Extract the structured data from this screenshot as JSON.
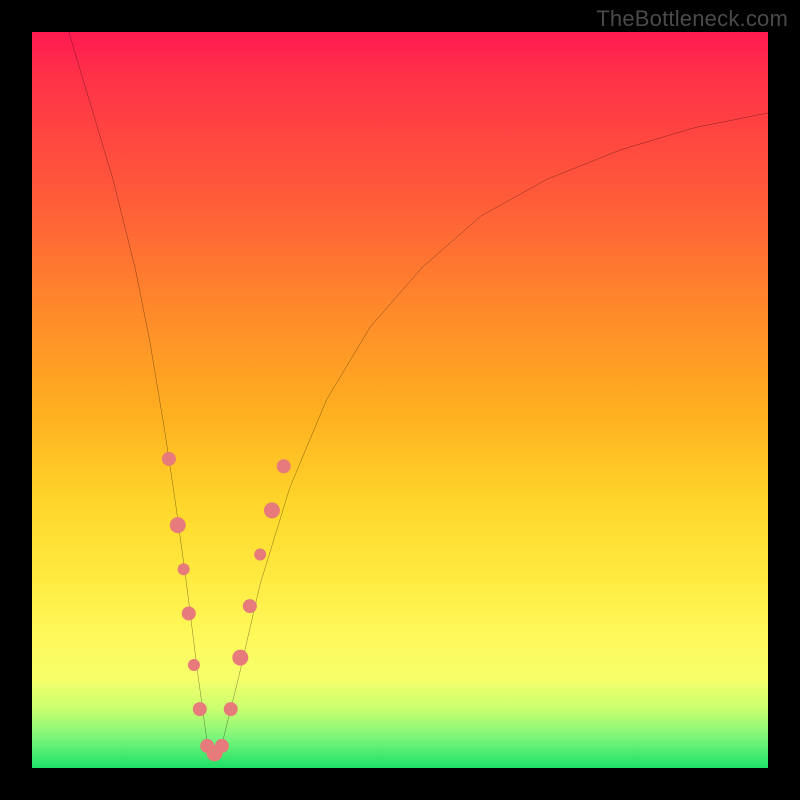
{
  "watermark": "TheBottleneck.com",
  "chart_data": {
    "type": "line",
    "title": "",
    "xlabel": "",
    "ylabel": "",
    "ylim": [
      0,
      100
    ],
    "xlim": [
      0,
      100
    ],
    "series": [
      {
        "name": "bottleneck-curve",
        "x": [
          5,
          8,
          11,
          14,
          16,
          18,
          19.5,
          21,
          22.5,
          24,
          25.5,
          28,
          31,
          35,
          40,
          46,
          53,
          61,
          70,
          80,
          90,
          100
        ],
        "values": [
          100,
          90,
          80,
          68,
          58,
          46,
          36,
          25,
          13,
          2,
          2,
          12,
          25,
          38,
          50,
          60,
          68,
          75,
          80,
          84,
          87,
          89
        ]
      }
    ],
    "markers": {
      "name": "highlight-beads",
      "color": "#e77a7a",
      "points": [
        {
          "x": 18.6,
          "y": 42,
          "r": 7
        },
        {
          "x": 19.8,
          "y": 33,
          "r": 8
        },
        {
          "x": 20.6,
          "y": 27,
          "r": 6
        },
        {
          "x": 21.3,
          "y": 21,
          "r": 7
        },
        {
          "x": 22.0,
          "y": 14,
          "r": 6
        },
        {
          "x": 22.8,
          "y": 8,
          "r": 7
        },
        {
          "x": 23.8,
          "y": 3,
          "r": 7
        },
        {
          "x": 24.8,
          "y": 2,
          "r": 8
        },
        {
          "x": 25.8,
          "y": 3,
          "r": 7
        },
        {
          "x": 27.0,
          "y": 8,
          "r": 7
        },
        {
          "x": 28.3,
          "y": 15,
          "r": 8
        },
        {
          "x": 29.6,
          "y": 22,
          "r": 7
        },
        {
          "x": 31.0,
          "y": 29,
          "r": 6
        },
        {
          "x": 32.6,
          "y": 35,
          "r": 8
        },
        {
          "x": 34.2,
          "y": 41,
          "r": 7
        }
      ]
    },
    "colors": {
      "curve": "#000000",
      "marker": "#e77a7a",
      "background_top": "#ff1a52",
      "background_bottom": "#1ee068",
      "frame": "#000000"
    }
  }
}
